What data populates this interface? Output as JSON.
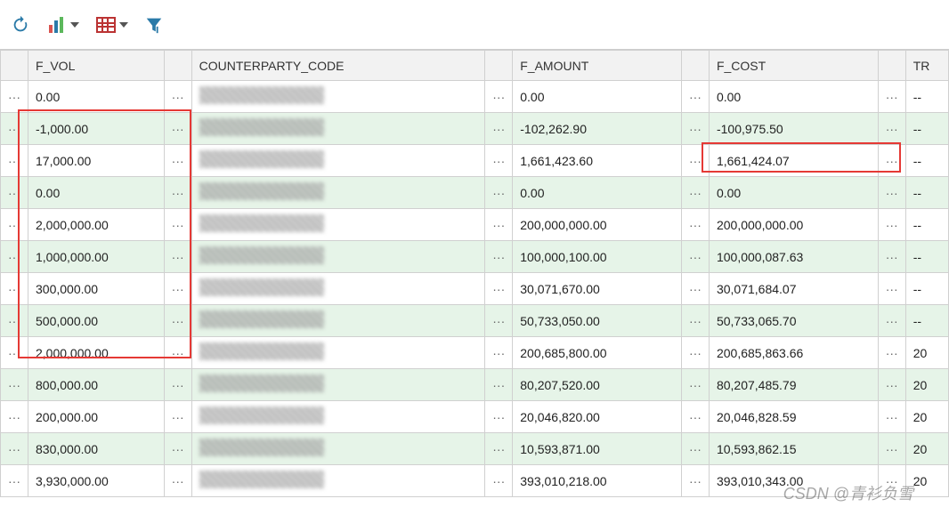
{
  "toolbar": {
    "icons": [
      "refresh-icon",
      "chart-icon",
      "grid-icon",
      "filter-icon"
    ]
  },
  "columns": {
    "fvol": "F_VOL",
    "counterparty": "COUNTERPARTY_CODE",
    "famount": "F_AMOUNT",
    "fcost": "F_COST",
    "tr": "TR"
  },
  "rows": [
    {
      "fvol": "0.00",
      "famount": "0.00",
      "fcost": "0.00",
      "tr": "--"
    },
    {
      "fvol": "-1,000.00",
      "famount": "-102,262.90",
      "fcost": "-100,975.50",
      "tr": "--"
    },
    {
      "fvol": "17,000.00",
      "famount": "1,661,423.60",
      "fcost": "1,661,424.07",
      "tr": "--"
    },
    {
      "fvol": "0.00",
      "famount": "0.00",
      "fcost": "0.00",
      "tr": "--"
    },
    {
      "fvol": "2,000,000.00",
      "famount": "200,000,000.00",
      "fcost": "200,000,000.00",
      "tr": "--"
    },
    {
      "fvol": "1,000,000.00",
      "famount": "100,000,100.00",
      "fcost": "100,000,087.63",
      "tr": "--"
    },
    {
      "fvol": "300,000.00",
      "famount": "30,071,670.00",
      "fcost": "30,071,684.07",
      "tr": "--"
    },
    {
      "fvol": "500,000.00",
      "famount": "50,733,050.00",
      "fcost": "50,733,065.70",
      "tr": "--"
    },
    {
      "fvol": "2,000,000.00",
      "famount": "200,685,800.00",
      "fcost": "200,685,863.66",
      "tr": "20"
    },
    {
      "fvol": "800,000.00",
      "famount": "80,207,520.00",
      "fcost": "80,207,485.79",
      "tr": "20"
    },
    {
      "fvol": "200,000.00",
      "famount": "20,046,820.00",
      "fcost": "20,046,828.59",
      "tr": "20"
    },
    {
      "fvol": "830,000.00",
      "famount": "10,593,871.00",
      "fcost": "10,593,862.15",
      "tr": "20"
    },
    {
      "fvol": "3,930,000.00",
      "famount": "393,010,218.00",
      "fcost": "393,010,343.00",
      "tr": "20"
    }
  ],
  "ellipsis": "···",
  "watermark": "CSDN @青衫负雪"
}
